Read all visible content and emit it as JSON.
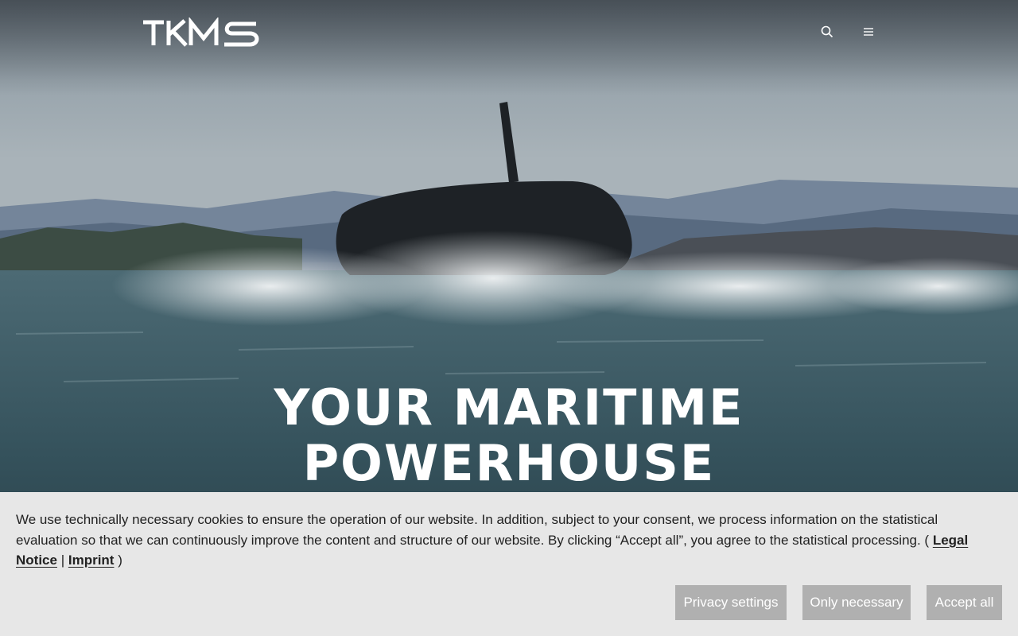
{
  "brand": {
    "logo_text": "TKMS"
  },
  "header": {
    "search_icon": "search-icon",
    "menu_icon": "hamburger-menu-icon"
  },
  "hero": {
    "headline_line1": "YOUR MARITIME",
    "headline_line2": "POWERHOUSE",
    "image_subject": "submarine-surfacing"
  },
  "cookie_banner": {
    "text": "We use technically necessary cookies to ensure the operation of our website. In addition, subject to your consent, we process information on the statistical evaluation so that we can continuously improve the content and structure of our website. By clicking “Accept all”, you agree to the statistical processing. (",
    "legal_notice_label": "Legal Notice",
    "separator": "|",
    "imprint_label": "Imprint",
    "closing": ")",
    "buttons": {
      "privacy_settings": "Privacy settings",
      "only_necessary": "Only necessary",
      "accept_all": "Accept all"
    }
  },
  "colors": {
    "banner_bg": "#e7e7e7",
    "button_bg": "#b0b0b0",
    "button_text": "#ffffff",
    "headline": "#ffffff"
  }
}
